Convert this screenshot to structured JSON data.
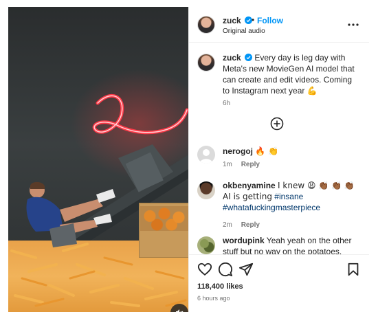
{
  "post": {
    "username": "zuck",
    "dot": "•",
    "follow_label": "Follow",
    "audio_label": "Original audio",
    "more_icon": "more-horizontal-icon"
  },
  "caption": {
    "username": "zuck",
    "text": "Every day is leg day with Meta's new MovieGen AI model that can create and edit videos. Coming to Instagram next year",
    "emoji": "💪",
    "time": "6h"
  },
  "load_more_icon": "plus-circle-icon",
  "comments": [
    {
      "username": "nerogoj",
      "text": "🔥 👏",
      "time": "1m",
      "reply": "Reply"
    },
    {
      "username": "okbenyamine",
      "text_before": "I knew 😩 👏🏾 👏🏾 👏🏾 AI is getting",
      "tag1": "#insane",
      "tag2": "#whatafuckingmasterpiece",
      "time": "2m",
      "reply": "Reply"
    },
    {
      "username": "wordupink",
      "text": "Yeah yeah on the other stuff but no way on the potatoes, those are"
    }
  ],
  "actions": {
    "like_icon": "heart-icon",
    "comment_icon": "comment-icon",
    "share_icon": "share-icon",
    "save_icon": "bookmark-icon",
    "likes": "118,400 likes",
    "posted": "6 hours ago"
  },
  "colors": {
    "accent": "#0095f6",
    "verified": "#0095f6",
    "neon": "#ff2a3a"
  }
}
